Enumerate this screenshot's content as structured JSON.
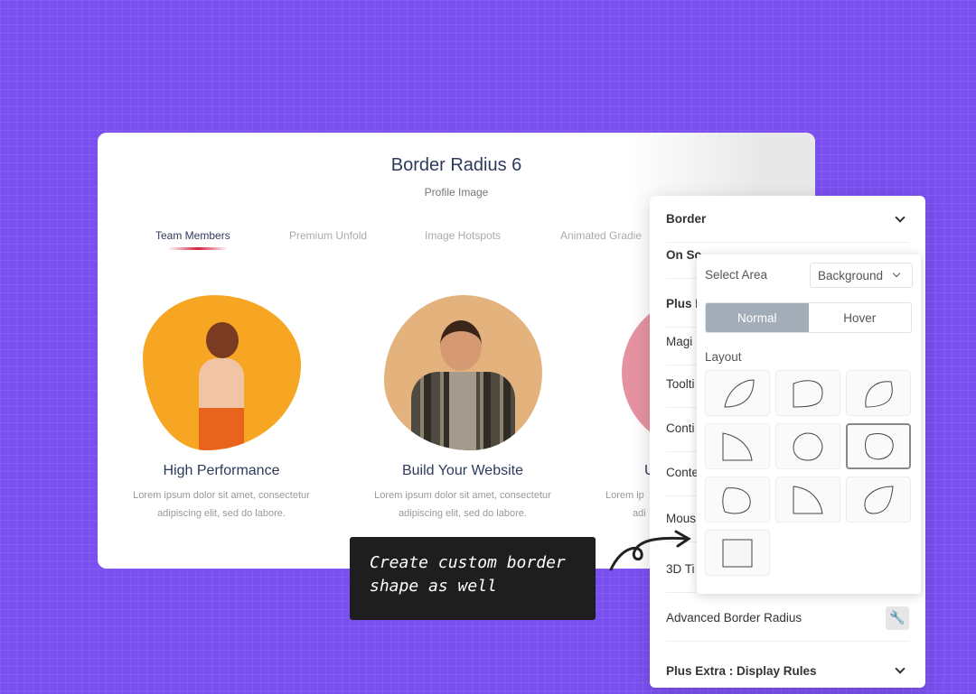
{
  "card": {
    "title": "Border Radius 6",
    "subtitle": "Profile Image",
    "tabs": [
      "Team Members",
      "Premium Unfold",
      "Image Hotspots",
      "Animated Gradie"
    ],
    "members": [
      {
        "name": "High Performance",
        "desc1": "Lorem ipsum dolor sit amet, consectetur",
        "desc2": "adipiscing elit, sed do labore.",
        "color": "#f7a624"
      },
      {
        "name": "Build Your Website",
        "desc1": "Lorem ipsum dolor sit amet, consectetur",
        "desc2": "adipiscing elit, sed do labore.",
        "color": "#e3b27d"
      },
      {
        "name": "U",
        "desc1": "Lorem ip",
        "desc2": "adi",
        "color": "#e07f8f"
      }
    ]
  },
  "panel": {
    "rows": [
      "Border",
      "On Sc",
      "Plus I",
      "Magi",
      "Toolti",
      "Conti",
      "Conte",
      "Mous",
      "3D Ti",
      "Advanced Border Radius",
      "Plus Extra : Display Rules"
    ]
  },
  "popup": {
    "select_label": "Select Area",
    "select_value": "Background",
    "normal": "Normal",
    "hover": "Hover",
    "layout_label": "Layout",
    "selected_layout": 6
  },
  "tooltip": {
    "line1": "Create custom border",
    "line2": "shape as well"
  },
  "colors": {
    "background": "#7a4ff0",
    "accent": "#d6203a"
  }
}
